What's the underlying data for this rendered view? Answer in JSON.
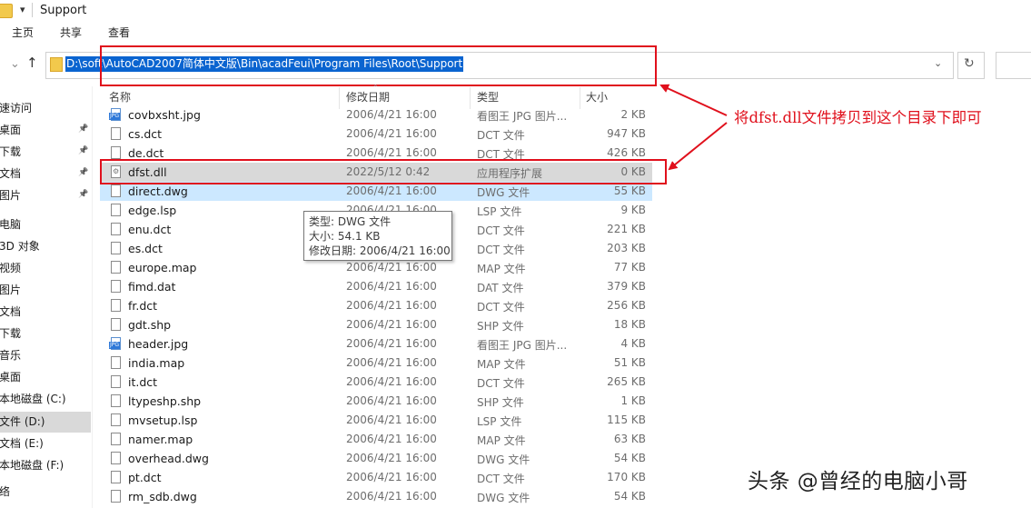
{
  "window": {
    "title": "Support"
  },
  "ribbon": {
    "tabs": [
      "主页",
      "共享",
      "查看"
    ]
  },
  "address": {
    "path": "D:\\soft\\AutoCAD2007简体中文版\\Bin\\acadFeui\\Program Files\\Root\\Support"
  },
  "sidebar": {
    "items": [
      {
        "label": "速访问",
        "pinned": false,
        "selected": false
      },
      {
        "label": "桌面",
        "pinned": true,
        "selected": false
      },
      {
        "label": "下载",
        "pinned": true,
        "selected": false
      },
      {
        "label": "文档",
        "pinned": true,
        "selected": false
      },
      {
        "label": "图片",
        "pinned": true,
        "selected": false
      },
      {
        "label": "电脑",
        "pinned": false,
        "selected": false
      },
      {
        "label": "3D 对象",
        "pinned": false,
        "selected": false
      },
      {
        "label": "视频",
        "pinned": false,
        "selected": false
      },
      {
        "label": "图片",
        "pinned": false,
        "selected": false
      },
      {
        "label": "文档",
        "pinned": false,
        "selected": false
      },
      {
        "label": "下载",
        "pinned": false,
        "selected": false
      },
      {
        "label": "音乐",
        "pinned": false,
        "selected": false
      },
      {
        "label": "桌面",
        "pinned": false,
        "selected": false
      },
      {
        "label": "本地磁盘 (C:)",
        "pinned": false,
        "selected": false
      },
      {
        "label": "文件 (D:)",
        "pinned": false,
        "selected": true
      },
      {
        "label": "文档 (E:)",
        "pinned": false,
        "selected": false
      },
      {
        "label": "本地磁盘 (F:)",
        "pinned": false,
        "selected": false
      },
      {
        "label": "络",
        "pinned": false,
        "selected": false
      }
    ]
  },
  "columns": {
    "name": "名称",
    "date": "修改日期",
    "type": "类型",
    "size": "大小"
  },
  "files": [
    {
      "name": "covbxsht.jpg",
      "date": "2006/4/21 16:00",
      "type": "看图王 JPG 图片...",
      "size": "2 KB",
      "icon": "jpg-icon"
    },
    {
      "name": "cs.dct",
      "date": "2006/4/21 16:00",
      "type": "DCT 文件",
      "size": "947 KB",
      "icon": "file-icon"
    },
    {
      "name": "de.dct",
      "date": "2006/4/21 16:00",
      "type": "DCT 文件",
      "size": "426 KB",
      "icon": "file-icon"
    },
    {
      "name": "dfst.dll",
      "date": "2022/5/12 0:42",
      "type": "应用程序扩展",
      "size": "0 KB",
      "icon": "dll-icon",
      "selected": true
    },
    {
      "name": "direct.dwg",
      "date": "2006/4/21 16:00",
      "type": "DWG 文件",
      "size": "55 KB",
      "icon": "file-icon",
      "hover": true
    },
    {
      "name": "edge.lsp",
      "date": "2006/4/21 16:00",
      "type": "LSP 文件",
      "size": "9 KB",
      "icon": "file-icon"
    },
    {
      "name": "enu.dct",
      "date": "2006/4/21 16:00",
      "type": "DCT 文件",
      "size": "221 KB",
      "icon": "file-icon"
    },
    {
      "name": "es.dct",
      "date": "2006/4/21 16:00",
      "type": "DCT 文件",
      "size": "203 KB",
      "icon": "file-icon"
    },
    {
      "name": "europe.map",
      "date": "2006/4/21 16:00",
      "type": "MAP 文件",
      "size": "77 KB",
      "icon": "file-icon"
    },
    {
      "name": "fimd.dat",
      "date": "2006/4/21 16:00",
      "type": "DAT 文件",
      "size": "379 KB",
      "icon": "file-icon"
    },
    {
      "name": "fr.dct",
      "date": "2006/4/21 16:00",
      "type": "DCT 文件",
      "size": "256 KB",
      "icon": "file-icon"
    },
    {
      "name": "gdt.shp",
      "date": "2006/4/21 16:00",
      "type": "SHP 文件",
      "size": "18 KB",
      "icon": "file-icon"
    },
    {
      "name": "header.jpg",
      "date": "2006/4/21 16:00",
      "type": "看图王 JPG 图片...",
      "size": "4 KB",
      "icon": "jpg-icon"
    },
    {
      "name": "india.map",
      "date": "2006/4/21 16:00",
      "type": "MAP 文件",
      "size": "51 KB",
      "icon": "file-icon"
    },
    {
      "name": "it.dct",
      "date": "2006/4/21 16:00",
      "type": "DCT 文件",
      "size": "265 KB",
      "icon": "file-icon"
    },
    {
      "name": "ltypeshp.shp",
      "date": "2006/4/21 16:00",
      "type": "SHP 文件",
      "size": "1 KB",
      "icon": "file-icon"
    },
    {
      "name": "mvsetup.lsp",
      "date": "2006/4/21 16:00",
      "type": "LSP 文件",
      "size": "115 KB",
      "icon": "file-icon"
    },
    {
      "name": "namer.map",
      "date": "2006/4/21 16:00",
      "type": "MAP 文件",
      "size": "63 KB",
      "icon": "file-icon"
    },
    {
      "name": "overhead.dwg",
      "date": "2006/4/21 16:00",
      "type": "DWG 文件",
      "size": "54 KB",
      "icon": "file-icon"
    },
    {
      "name": "pt.dct",
      "date": "2006/4/21 16:00",
      "type": "DCT 文件",
      "size": "170 KB",
      "icon": "file-icon"
    },
    {
      "name": "rm_sdb.dwg",
      "date": "2006/4/21 16:00",
      "type": "DWG 文件",
      "size": "54 KB",
      "icon": "file-icon"
    }
  ],
  "tooltip": {
    "type_line": "类型: DWG 文件",
    "size_line": "大小: 54.1 KB",
    "date_line": "修改日期: 2006/4/21 16:00"
  },
  "annotation": {
    "text": "将dfst.dll文件拷贝到这个目录下即可",
    "color": "#e0101c"
  },
  "watermark": {
    "text": "头条 @曾经的电脑小哥"
  },
  "colors": {
    "selection_blue": "#0a64d0",
    "hover_row": "#cce8ff",
    "selected_row": "#d9d9d9",
    "highlight_red": "#e0101c"
  }
}
